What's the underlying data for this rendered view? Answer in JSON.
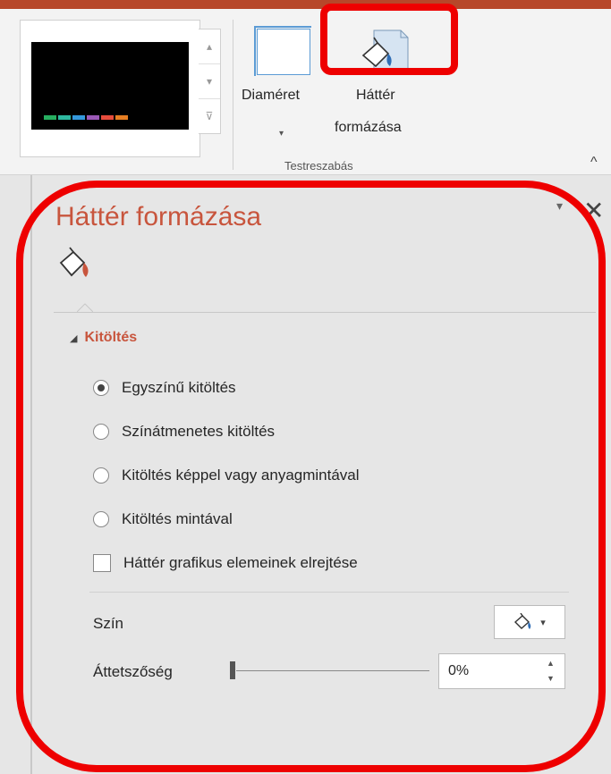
{
  "ribbon": {
    "slide_size_label": "Diaméret",
    "slide_size_arrow": "▾",
    "bg_format_label_1": "Háttér",
    "bg_format_label_2": "formázása",
    "group_label": "Testreszabás",
    "gallery_up": "▴",
    "gallery_down": "▾",
    "gallery_more": "⊽",
    "collapse": "^"
  },
  "swatch_colors": [
    "#27ae60",
    "#2eb8a0",
    "#3498db",
    "#9b59b6",
    "#e74c3c",
    "#e67e22"
  ],
  "pane": {
    "title": "Háttér formázása",
    "close": "✕",
    "pin": "▾",
    "section": "Kitöltés",
    "options": [
      "Egyszínű kitöltés",
      "Színátmenetes kitöltés",
      "Kitöltés képpel vagy anyagmintával",
      "Kitöltés mintával"
    ],
    "hide_graphics": "Háttér grafikus elemeinek elrejtése",
    "color_label": "Szín",
    "color_dropdown": "▾",
    "transparency_label": "Áttetszőség",
    "transparency_value": "0%",
    "spin_up": "▲",
    "spin_down": "▼"
  },
  "accent": "#c8553d"
}
